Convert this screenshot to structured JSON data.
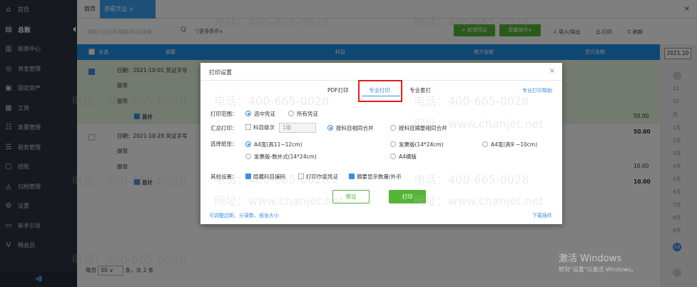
{
  "sidebar": {
    "items": [
      {
        "label": "首页",
        "icon": "home-icon",
        "glyph": "⌂"
      },
      {
        "label": "总账",
        "icon": "ledger-icon",
        "glyph": "▤",
        "active": true
      },
      {
        "label": "报表中心",
        "icon": "report-icon",
        "glyph": "▥"
      },
      {
        "label": "资金管理",
        "icon": "fund-icon",
        "glyph": "◎"
      },
      {
        "label": "固定资产",
        "icon": "asset-icon",
        "glyph": "▣"
      },
      {
        "label": "工资",
        "icon": "salary-icon",
        "glyph": "▦"
      },
      {
        "label": "发票管理",
        "icon": "invoice-icon",
        "glyph": "☷"
      },
      {
        "label": "税务管理",
        "icon": "tax-icon",
        "glyph": "☰"
      },
      {
        "label": "结账",
        "icon": "close-period-icon",
        "glyph": "▢"
      },
      {
        "label": "归档管理",
        "icon": "archive-icon",
        "glyph": "◬"
      },
      {
        "label": "设置",
        "icon": "settings-icon",
        "glyph": "⚙"
      },
      {
        "label": "新手引导",
        "icon": "guide-icon",
        "glyph": "▭"
      },
      {
        "label": "畅会员",
        "icon": "member-icon",
        "glyph": "V"
      }
    ],
    "collapse_glyph": "◂▮"
  },
  "topbar": {
    "home_tab": "首页",
    "active_tab": "查看凭证",
    "tab_close": "×",
    "window_close": "×"
  },
  "toolbar": {
    "search_placeholder": "凭输入凭证号/摘要/科目/金额...",
    "search_icon_glyph": "Q",
    "more_conditions": "▽更多条件∨",
    "new_voucher": "+ 新增凭证",
    "batch_ops": "批量操作∨",
    "import_export": "⇩ 导入/导出",
    "print": "⎙ 打印",
    "refresh": "C 刷新"
  },
  "table": {
    "headers": {
      "select_all": "全选",
      "summary": "摘要",
      "account": "科目",
      "debit": "借方金额",
      "credit": "贷方金额"
    },
    "vouchers": [
      {
        "date_line": "日期：2021-10-01   凭证字号",
        "lines": [
          "提现",
          "提现"
        ],
        "total_label": "总计",
        "debit_line": "50.00",
        "debit_total": "50.00",
        "checked": true
      },
      {
        "date_line": "日期：2021-10-29   凭证字号",
        "lines": [
          "提现",
          "提现"
        ],
        "total_label": "总计",
        "debit_line": "10.00",
        "debit_total": "10.00",
        "checked": false
      }
    ]
  },
  "pagination": {
    "prefix": "每页",
    "page_size": "50",
    "suffix": "条，共 2 条"
  },
  "month_bar": {
    "year": "2021.10",
    "months": [
      "11",
      "12",
      "月",
      "1月",
      "2月",
      "3月",
      "4月",
      "5月",
      "6月",
      "7月",
      "8月",
      "9月"
    ],
    "current": "10"
  },
  "modal": {
    "title": "打印设置",
    "close": "×",
    "tabs": [
      {
        "label": "PDF打印",
        "active": false
      },
      {
        "label": "专业打印",
        "active": true
      },
      {
        "label": "专业套打",
        "active": false
      }
    ],
    "help_link": "专业打印帮助",
    "print_range": {
      "label": "打印范围：",
      "options": [
        {
          "label": "选中凭证",
          "checked": true
        },
        {
          "label": "所有凭证",
          "checked": false
        }
      ]
    },
    "summary_print": {
      "label": "汇总打印：",
      "level_checkbox": "科目级次",
      "level_value": "1级",
      "options": [
        {
          "label": "按科目相同合并",
          "checked": true
        },
        {
          "label": "按科目摘要相同合并",
          "checked": false
        }
      ]
    },
    "paper": {
      "label": "选择纸张：",
      "options": [
        {
          "label": "A4宽(高11~12cm)",
          "checked": true
        },
        {
          "label": "发票版(14*24cm)",
          "checked": false
        },
        {
          "label": "A4宽(高9 ~10cm)",
          "checked": false
        },
        {
          "label": "发票版-数外式(14*24cm)",
          "checked": false
        },
        {
          "label": "A4横版",
          "checked": false
        }
      ]
    },
    "other": {
      "label": "其他设置：",
      "options": [
        {
          "label": "隐藏科目编码",
          "checked": true
        },
        {
          "label": "打印作废凭证",
          "checked": false
        },
        {
          "label": "摘要显示数量/外币",
          "checked": true
        }
      ]
    },
    "preview_button": "预览",
    "print_button": "打印",
    "bottom_link_left": "可调整边距、分录数、纸张大小",
    "bottom_link_right": "下载插件"
  },
  "watermark": {
    "phone": "电话：400-665-0028",
    "site": "网址：www.chanjet.net"
  },
  "activation": {
    "title": "激活 Windows",
    "subtitle": "转到\"设置\"以激活 Windows。"
  },
  "colors": {
    "sidebar": "#2c3441",
    "accent_blue": "#39a0f0",
    "header_blue": "#1f8ee6",
    "green": "#54b436",
    "highlight_red": "#e0201c"
  }
}
